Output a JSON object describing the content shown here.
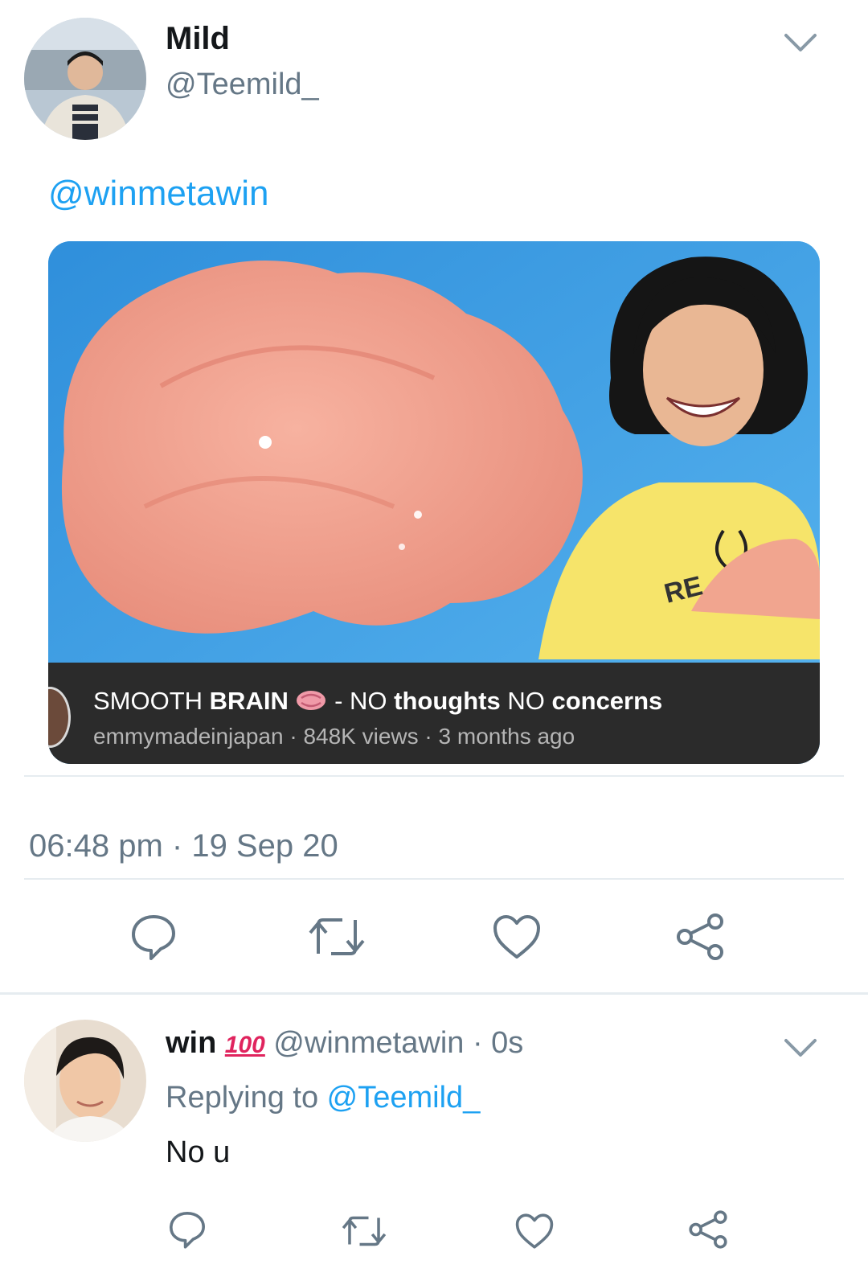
{
  "tweet": {
    "author_name": "Mild",
    "author_handle": "@Teemild_",
    "mention": "@winmetawin",
    "timestamp": "06:48 pm · 19 Sep 20",
    "media": {
      "title_prefix": "SMOOTH ",
      "title_bold1": "BRAIN",
      "title_dash": " - NO ",
      "title_bold2": "thoughts",
      "title_mid": " NO ",
      "title_bold3": "concerns",
      "meta": "emmymadeinjapan · 848K views · 3 months ago",
      "overlay_text": "RE"
    }
  },
  "reply": {
    "author_name": "win",
    "badge": "100",
    "handle_time": "@winmetawin · 0s",
    "replying_prefix": "Replying to ",
    "replying_handle": "@Teemild_",
    "text": "No u"
  },
  "icons": [
    "reply-icon",
    "retweet-icon",
    "like-icon",
    "share-icon",
    "chevron-down-icon",
    "brain-icon"
  ],
  "colors": {
    "link": "#1da1f2",
    "secondary": "#657786",
    "divider": "#e6ecf0"
  }
}
